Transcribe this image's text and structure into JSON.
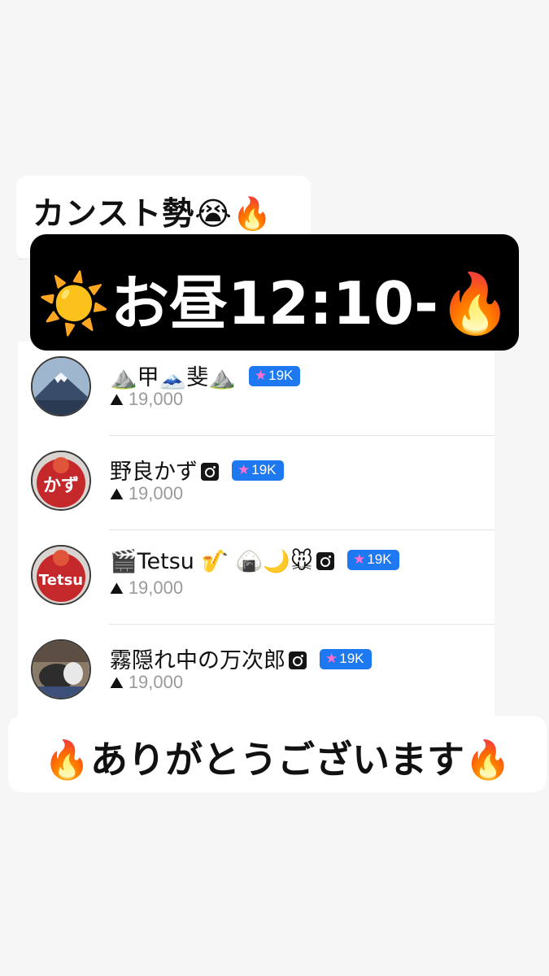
{
  "title": "カンスト勢😭🔥",
  "banner": "☀️お昼12:10-🔥",
  "thanks": "🔥ありがとうございます🔥",
  "badge_color": "#1e78f0",
  "users": [
    {
      "name": "⛰️甲🗻斐⛰️",
      "instagram": false,
      "badge": "19K",
      "score": "19,000",
      "avatar": "mount-fuji-photo"
    },
    {
      "name": "野良かず",
      "instagram": true,
      "badge": "19K",
      "score": "19,000",
      "avatar": "oni-kazu-logo"
    },
    {
      "name": "🎬Tetsu 🎷 🍙🌙🐭",
      "instagram": true,
      "badge": "19K",
      "score": "19,000",
      "avatar": "oni-tetsu-logo"
    },
    {
      "name": "霧隠れ中の万次郎",
      "instagram": true,
      "badge": "19K",
      "score": "19,000",
      "avatar": "cat-photo"
    }
  ]
}
